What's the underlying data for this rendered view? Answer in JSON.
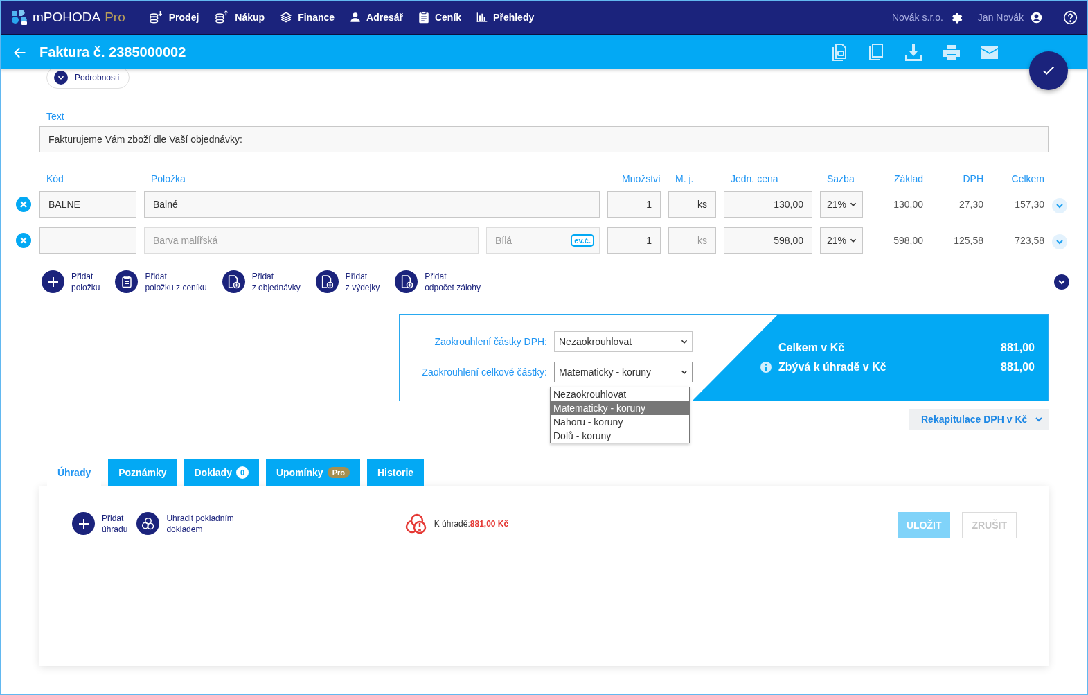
{
  "app": {
    "name": "mPOHODA",
    "edition": "Pro"
  },
  "nav": [
    {
      "label": "Prodej"
    },
    {
      "label": "Nákup"
    },
    {
      "label": "Finance"
    },
    {
      "label": "Adresář"
    },
    {
      "label": "Ceník"
    },
    {
      "label": "Přehledy"
    }
  ],
  "account": {
    "company": "Novák s.r.o.",
    "user": "Jan Novák"
  },
  "document": {
    "title": "Faktura č. 2385000002"
  },
  "details_toggle": "Podrobnosti",
  "text_field": {
    "label": "Text",
    "value": "Fakturujeme Vám zboží dle Vaší objednávky:"
  },
  "items": {
    "columns": [
      "Kód",
      "Položka",
      "Množství",
      "M. j.",
      "Jedn. cena",
      "Sazba",
      "Základ",
      "DPH",
      "Celkem"
    ],
    "rows": [
      {
        "code": {
          "value": "BALNE"
        },
        "name": {
          "value": "Balné"
        },
        "quantity": {
          "value": "1"
        },
        "unit": {
          "value": "ks"
        },
        "price": {
          "value": "130,00"
        },
        "rate": "21%",
        "base": "130,00",
        "vat": "27,30",
        "total": "157,30"
      },
      {
        "name": {
          "placeholder": "Barva malířská"
        },
        "variant": {
          "placeholder": "Bílá"
        },
        "serial_badge": "ev.č.",
        "quantity": {
          "value": "1"
        },
        "unit": {
          "placeholder": "ks"
        },
        "price": {
          "value": "598,00"
        },
        "rate": "21%",
        "base": "598,00",
        "vat": "125,58",
        "total": "723,58"
      }
    ]
  },
  "add_actions": [
    "Přidat\npoložku",
    "Přidat\npoložku z ceníku",
    "Přidat\nz objednávky",
    "Přidat\nz výdejky",
    "Přidat\nodpočet zálohy"
  ],
  "rounding": [
    {
      "label": "Zaokrouhlení částky DPH:",
      "value": "Nezaokrouhlovat",
      "expanded": false
    },
    {
      "label": "Zaokrouhlení celkové částky:",
      "value": "Matematicky - koruny",
      "expanded": true,
      "options": [
        {
          "label": "Nezaokrouhlovat",
          "selected": false
        },
        {
          "label": "Matematicky - koruny",
          "selected": true
        },
        {
          "label": "Nahoru - koruny",
          "selected": false
        },
        {
          "label": "Dolů - koruny",
          "selected": false
        }
      ]
    }
  ],
  "totals": [
    {
      "label": "Celkem v Kč",
      "value": "881,00",
      "info": false
    },
    {
      "label": "Zbývá k úhradě v Kč",
      "value": "881,00",
      "info": true
    }
  ],
  "vat_recap": "Rekapitulace DPH v Kč",
  "tabs": [
    {
      "label": "Úhrady",
      "selected": true
    },
    {
      "label": "Poznámky",
      "selected": false
    },
    {
      "label": "Doklady",
      "selected": false,
      "badge": "0",
      "kind": "count"
    },
    {
      "label": "Upomínky",
      "selected": false,
      "badge": "Pro",
      "kind": "edition"
    },
    {
      "label": "Historie",
      "selected": false
    }
  ],
  "payments": {
    "actions": [
      "Přidat\núhradu",
      "Uhradit pokladním\ndokladem"
    ],
    "due": {
      "label": "K úhradě:",
      "amount": "881,00 Kč"
    },
    "buttons": [
      {
        "label": "ULOŽIT",
        "kind": "primary",
        "disabled": true
      },
      {
        "label": "ZRUŠIT",
        "kind": "secondary",
        "disabled": true
      }
    ]
  }
}
